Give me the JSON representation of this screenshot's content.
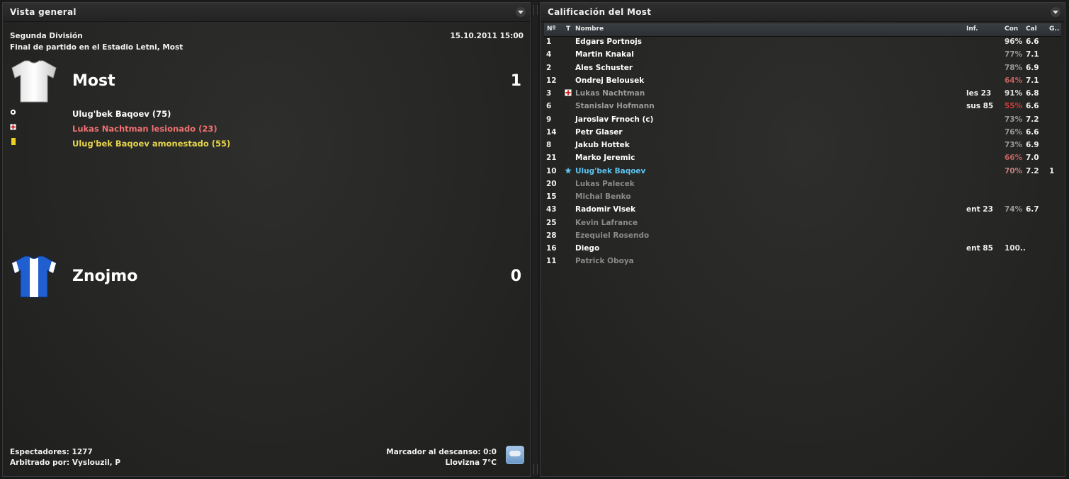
{
  "overview": {
    "title": "Vista general",
    "competition": "Segunda División",
    "venue_line": "Final de partido en el Estadio Letni, Most",
    "datetime": "15.10.2011 15:00",
    "home": {
      "name": "Most",
      "score": "1",
      "shirt_colors": [
        "#f2f2f2",
        "#cfcfcf"
      ]
    },
    "away": {
      "name": "Znojmo",
      "score": "0",
      "shirt_colors": [
        "#1f5fd0",
        "#ffffff"
      ]
    },
    "events": [
      {
        "icon": "goal-ball-icon",
        "text": "Ulug'bek Baqoev (75)",
        "color": "#ffffff"
      },
      {
        "icon": "injury-cross-icon",
        "text": "Lukas Nachtman lesionado (23)",
        "color": "#f07070"
      },
      {
        "icon": "yellow-card-icon",
        "text": "Ulug'bek Baqoev amonestado (55)",
        "color": "#e8d64a"
      }
    ],
    "attendance": "Espectadores: 1277",
    "referee": "Arbitrado por: Vyslouzil, P",
    "halftime": "Marcador al descanso: 0:0",
    "weather": "Llovizna 7°C"
  },
  "ratings": {
    "title": "Calificación del Most",
    "columns": {
      "num": "Nº",
      "t": "T",
      "name": "Nombre",
      "inf": "Inf.",
      "con": "Con",
      "cal": "Cal",
      "g": "G.."
    },
    "rows": [
      {
        "num": "1",
        "icon": "",
        "name": "Edgars Portnojs",
        "inf": "",
        "con": "96%",
        "cal": "6.6",
        "g": "",
        "name_color": "#ffffff",
        "con_color": "#e0e0e0"
      },
      {
        "num": "4",
        "icon": "",
        "name": "Martin Knakal",
        "inf": "",
        "con": "77%",
        "cal": "7.1",
        "g": "",
        "name_color": "#ffffff",
        "con_color": "#9a9a9a"
      },
      {
        "num": "2",
        "icon": "",
        "name": "Ales Schuster",
        "inf": "",
        "con": "78%",
        "cal": "6.9",
        "g": "",
        "name_color": "#ffffff",
        "con_color": "#9a9a9a"
      },
      {
        "num": "12",
        "icon": "",
        "name": "Ondrej Belousek",
        "inf": "",
        "con": "64%",
        "cal": "7.1",
        "g": "",
        "name_color": "#ffffff",
        "con_color": "#c06060"
      },
      {
        "num": "3",
        "icon": "injury-cross-icon",
        "name": "Lukas Nachtman",
        "inf": "les 23",
        "con": "91%",
        "cal": "6.8",
        "g": "",
        "name_color": "#9a9a9a",
        "con_color": "#e0e0e0"
      },
      {
        "num": "6",
        "icon": "",
        "name": "Stanislav Hofmann",
        "inf": "sus 85",
        "con": "55%",
        "cal": "6.6",
        "g": "",
        "name_color": "#9a9a9a",
        "con_color": "#d03a3a"
      },
      {
        "num": "9",
        "icon": "",
        "name": "Jaroslav Frnoch (c)",
        "inf": "",
        "con": "73%",
        "cal": "7.2",
        "g": "",
        "name_color": "#ffffff",
        "con_color": "#9a9a9a"
      },
      {
        "num": "14",
        "icon": "",
        "name": "Petr Glaser",
        "inf": "",
        "con": "76%",
        "cal": "6.6",
        "g": "",
        "name_color": "#ffffff",
        "con_color": "#9a9a9a"
      },
      {
        "num": "8",
        "icon": "",
        "name": "Jakub Hottek",
        "inf": "",
        "con": "73%",
        "cal": "6.9",
        "g": "",
        "name_color": "#ffffff",
        "con_color": "#9a9a9a"
      },
      {
        "num": "21",
        "icon": "",
        "name": "Marko Jeremic",
        "inf": "",
        "con": "66%",
        "cal": "7.0",
        "g": "",
        "name_color": "#ffffff",
        "con_color": "#c06060"
      },
      {
        "num": "10",
        "icon": "star-icon",
        "name": "Ulug'bek Baqoev",
        "inf": "",
        "con": "70%",
        "cal": "7.2",
        "g": "1",
        "name_color": "#5ec3f0",
        "con_color": "#c08080"
      },
      {
        "num": "20",
        "icon": "",
        "name": "Lukas Palecek",
        "inf": "",
        "con": "",
        "cal": "",
        "g": "",
        "name_color": "#8a8a8a",
        "con_color": "#9a9a9a"
      },
      {
        "num": "15",
        "icon": "",
        "name": "Michal Benko",
        "inf": "",
        "con": "",
        "cal": "",
        "g": "",
        "name_color": "#8a8a8a",
        "con_color": "#9a9a9a"
      },
      {
        "num": "43",
        "icon": "",
        "name": "Radomir Visek",
        "inf": "ent 23",
        "con": "74%",
        "cal": "6.7",
        "g": "",
        "name_color": "#ffffff",
        "con_color": "#9a9a9a"
      },
      {
        "num": "25",
        "icon": "",
        "name": "Kevin Lafrance",
        "inf": "",
        "con": "",
        "cal": "",
        "g": "",
        "name_color": "#8a8a8a",
        "con_color": "#9a9a9a"
      },
      {
        "num": "28",
        "icon": "",
        "name": "Ezequiel Rosendo",
        "inf": "",
        "con": "",
        "cal": "",
        "g": "",
        "name_color": "#8a8a8a",
        "con_color": "#9a9a9a"
      },
      {
        "num": "16",
        "icon": "",
        "name": "Diego",
        "inf": "ent 85",
        "con": "100..",
        "cal": "",
        "g": "",
        "name_color": "#ffffff",
        "con_color": "#e0e0e0"
      },
      {
        "num": "11",
        "icon": "",
        "name": "Patrick Oboya",
        "inf": "",
        "con": "",
        "cal": "",
        "g": "",
        "name_color": "#8a8a8a",
        "con_color": "#9a9a9a"
      }
    ]
  }
}
